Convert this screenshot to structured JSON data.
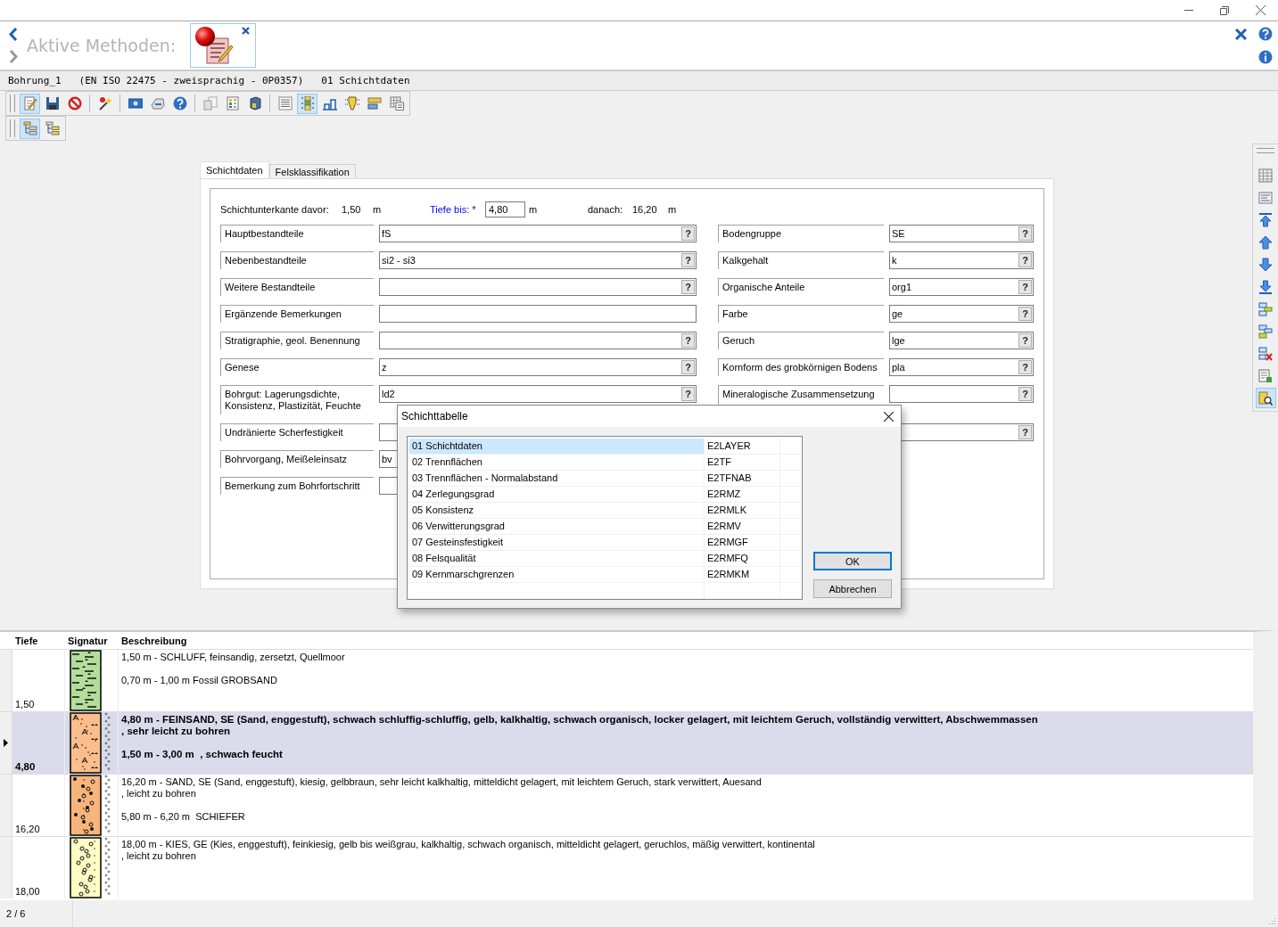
{
  "header": {
    "title": "Aktive Methoden:"
  },
  "breadcrumb": [
    "Bohrung_1",
    "(EN ISO 22475 - zweisprachig - 0P0357)",
    "01 Schichtdaten"
  ],
  "toolbars": [
    {
      "groups": [
        [
          {
            "selected": true
          },
          {
            "selected": false
          },
          {
            "selected": false
          }
        ],
        [
          {
            "selected": false
          }
        ],
        [
          {
            "selected": false
          },
          {
            "selected": false
          },
          {
            "selected": false
          }
        ],
        [
          {
            "selected": false
          },
          {
            "selected": false
          },
          {
            "selected": false
          }
        ],
        [
          {
            "selected": false
          },
          {
            "selected": true
          },
          {
            "selected": false
          },
          {
            "selected": false
          },
          {
            "selected": false
          },
          {
            "selected": false
          }
        ]
      ]
    },
    {
      "groups": [
        [
          {
            "selected": true
          },
          {
            "selected": false
          }
        ]
      ]
    }
  ],
  "side_toolbar": [
    {
      "selected": false
    },
    {
      "selected": false
    },
    {
      "selected": false
    },
    {
      "selected": false
    },
    {
      "selected": false
    },
    {
      "selected": false
    },
    {
      "selected": false
    },
    {
      "selected": false
    },
    {
      "selected": false
    },
    {
      "selected": false
    },
    {
      "selected": true
    }
  ],
  "form": {
    "tabs": [
      {
        "label": "Schichtdaten",
        "selected": true
      },
      {
        "label": "Felsklassifikation",
        "selected": false
      }
    ],
    "depth": {
      "before_label": "Schichtunterkante davor:",
      "before_value": "1,50",
      "before_unit": "m",
      "depth_label": "Tiefe bis: *",
      "depth_value": "4,80",
      "depth_unit": "m",
      "after_label": "danach:",
      "after_value": "16,20",
      "after_unit": "m"
    },
    "left_fields": [
      {
        "label": "Hauptbestandteile",
        "value": "fS",
        "button": "?"
      },
      {
        "label": "Nebenbestandteile",
        "value": "si2 - si3",
        "button": "?"
      },
      {
        "label": "Weitere Bestandteile",
        "button": "?"
      },
      {
        "label": "Ergänzende Bemerkungen"
      },
      {
        "label": "Stratigraphie, geol. Benennung",
        "button": "?"
      },
      {
        "label": "Genese",
        "value": "z",
        "button": "?"
      },
      {
        "label": "Bohrgut: Lagerungsdichte, Konsistenz, Plastizität, Feuchte",
        "value": "ld2",
        "button": "?"
      },
      {
        "label": "Undränierte Scherfestigkeit"
      },
      {
        "label": "Bohrvorgang, Meißeleinsatz",
        "value": "bv"
      },
      {
        "label": "Bemerkung zum Bohrfortschritt"
      }
    ],
    "right_fields": [
      {
        "label": "Bodengruppe",
        "value": "SE",
        "button": "?"
      },
      {
        "label": "Kalkgehalt",
        "value": "k",
        "button": "?"
      },
      {
        "label": "Organische Anteile",
        "value": "org1",
        "button": "?"
      },
      {
        "label": "Farbe",
        "value": "ge",
        "button": "?"
      },
      {
        "label": "Geruch",
        "value": "lge",
        "button": "?"
      },
      {
        "label": "Kornform des grobkörnigen Bodens",
        "value": "pla",
        "button": "?"
      },
      {
        "label": "Mineralogische Zusammensetzung",
        "button": "?"
      },
      {
        "button": "?"
      }
    ]
  },
  "dialog": {
    "title": "Schichttabelle",
    "rows": [
      {
        "name": "01 Schichtdaten",
        "code": "E2LAYER",
        "selected": true
      },
      {
        "name": "02 Trennflächen",
        "code": "E2TF",
        "selected": false
      },
      {
        "name": "03 Trennflächen - Normalabstand",
        "code": "E2TFNAB",
        "selected": false
      },
      {
        "name": "04 Zerlegungsgrad",
        "code": "E2RMZ",
        "selected": false
      },
      {
        "name": "05 Konsistenz",
        "code": "E2RMLK",
        "selected": false
      },
      {
        "name": "06 Verwitterungsgrad",
        "code": "E2RMV",
        "selected": false
      },
      {
        "name": "07 Gesteinsfestigkeit",
        "code": "E2RMGF",
        "selected": false
      },
      {
        "name": "08 Felsqualität",
        "code": "E2RMFQ",
        "selected": false
      },
      {
        "name": "09 Kernmarschgrenzen",
        "code": "E2RMKM",
        "selected": false
      }
    ],
    "buttons": [
      {
        "label": "OK",
        "default": true
      },
      {
        "label": "Abbrechen",
        "default": false
      }
    ]
  },
  "layers": {
    "columns": [
      "Tiefe",
      "Signatur",
      "Beschreibung"
    ],
    "rows": [
      {
        "depth": "1,50",
        "kind": "silt",
        "color": "#b4dd9b",
        "dots": false,
        "selected": false,
        "paragraphs": [
          [
            "1,50 m - SCHLUFF, feinsandig, zersetzt, Quellmoor"
          ],
          [
            "0,70 m - 1,00 m Fossil GROBSAND"
          ]
        ]
      },
      {
        "depth": "4,80",
        "kind": "fine_sand",
        "color": "#f9be8c",
        "dots": true,
        "selected": true,
        "paragraphs": [
          [
            "4,80 m - FEINSAND, SE (Sand, enggestuft), schwach schluffig-schluffig, gelb, kalkhaltig, schwach organisch, locker gelagert, mit leichtem Geruch, vollständig verwittert, Abschwemmassen",
            ", sehr leicht zu bohren"
          ],
          [
            "1,50 m - 3,00 m  , schwach feucht"
          ]
        ]
      },
      {
        "depth": "16,20",
        "kind": "sand",
        "color": "#f7b57c",
        "dots": true,
        "selected": false,
        "paragraphs": [
          [
            "16,20 m - SAND, SE (Sand, enggestuft), kiesig, gelbbraun, sehr leicht kalkhaltig, mitteldicht gelagert, mit leichtem Geruch, stark verwittert, Auesand",
            ", leicht zu bohren"
          ],
          [
            "5,80 m - 6,20 m  SCHIEFER"
          ]
        ]
      },
      {
        "depth": "18,00",
        "kind": "gravel",
        "color": "#fffcc4",
        "dots": true,
        "selected": false,
        "paragraphs": [
          [
            "18,00 m - KIES, GE (Kies, enggestuft), feinkiesig, gelb bis weißgrau, kalkhaltig, schwach organisch, mitteldicht gelagert, geruchlos, mäßig verwittert, kontinental",
            ", leicht zu bohren"
          ]
        ]
      }
    ]
  },
  "status_bar": {
    "position": "2 / 6"
  }
}
